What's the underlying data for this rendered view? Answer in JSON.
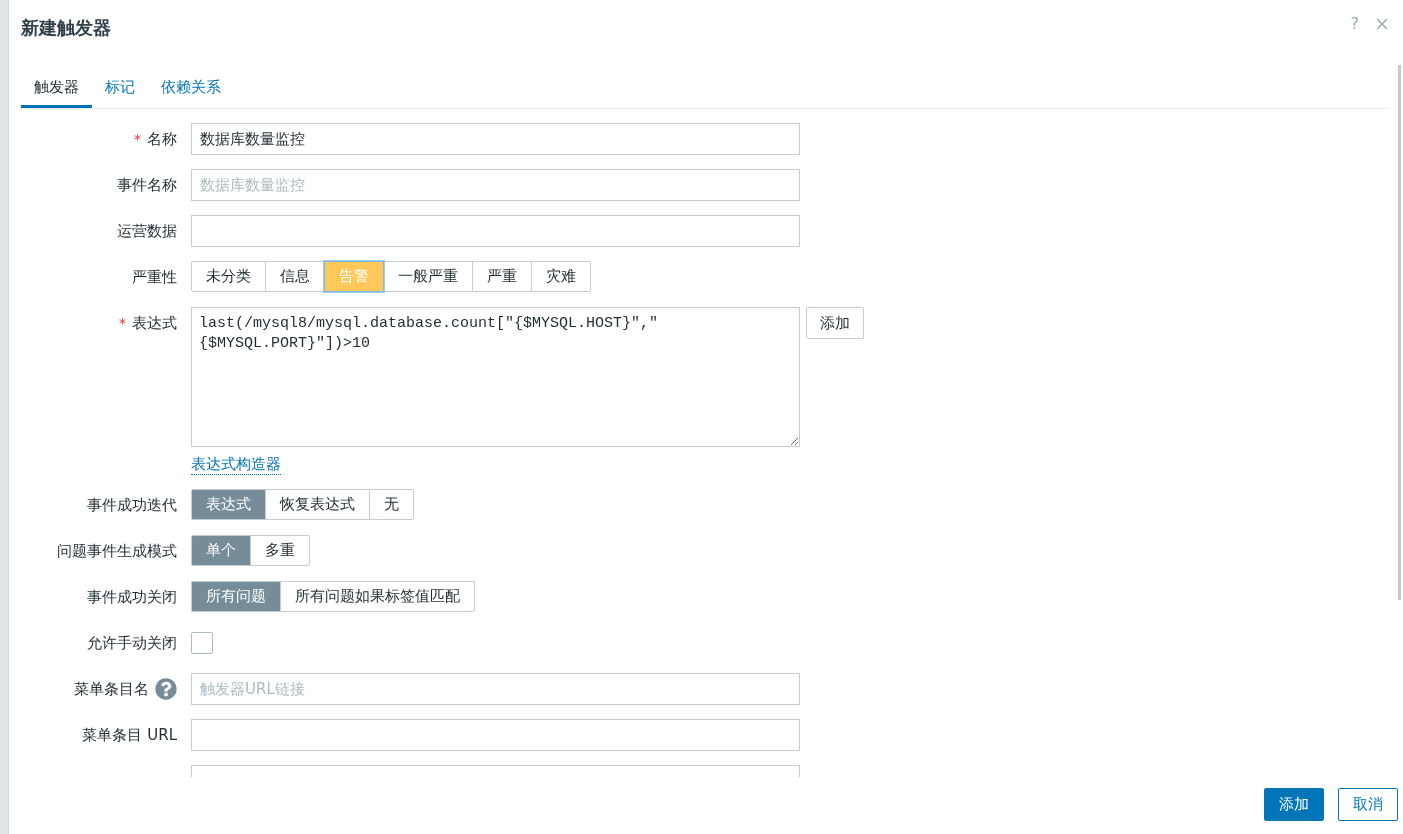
{
  "dialog": {
    "title": "新建触发器",
    "help": "?"
  },
  "tabs": [
    {
      "label": "触发器",
      "selected": true
    },
    {
      "label": "标记",
      "selected": false
    },
    {
      "label": "依赖关系",
      "selected": false
    }
  ],
  "form": [
    {
      "kind": "text",
      "label": "名称",
      "mark": "*",
      "value": "数据库数量监控"
    },
    {
      "kind": "text",
      "label": "事件名称",
      "placeholder": "数据库数量监控"
    },
    {
      "kind": "text",
      "label": "运营数据"
    },
    {
      "kind": "severity",
      "label": "严重性",
      "options": [
        {
          "label": "未分类",
          "selected": false
        },
        {
          "label": "信息",
          "selected": false
        },
        {
          "label": "告警",
          "selected": true
        },
        {
          "label": "一般严重",
          "selected": false
        },
        {
          "label": "严重",
          "selected": false
        },
        {
          "label": "灾难",
          "selected": false
        }
      ]
    },
    {
      "kind": "expression",
      "label": "表达式",
      "mark": "*",
      "value": "last(/mysql8/mysql.database.count[\"{$MYSQL.HOST}\",\"{$MYSQL.PORT}\"])>10",
      "button": "添加",
      "link": "表达式构造器"
    },
    {
      "kind": "segmented",
      "label": "事件成功迭代",
      "options": [
        {
          "label": "表达式",
          "selected": true
        },
        {
          "label": "恢复表达式",
          "selected": false
        },
        {
          "label": "无",
          "selected": false
        }
      ]
    },
    {
      "kind": "segmented",
      "label": "问题事件生成模式",
      "options": [
        {
          "label": "单个",
          "selected": true
        },
        {
          "label": "多重",
          "selected": false
        }
      ]
    },
    {
      "kind": "segmented",
      "label": "事件成功关闭",
      "options": [
        {
          "label": "所有问题",
          "selected": true
        },
        {
          "label": "所有问题如果标签值匹配",
          "selected": false
        }
      ]
    },
    {
      "kind": "checkbox",
      "label": "允许手动关闭",
      "checked": false
    },
    {
      "kind": "text",
      "label": "菜单条目名",
      "help": true,
      "placeholder": "触发器URL链接"
    },
    {
      "kind": "text",
      "label": "菜单条目 URL"
    },
    {
      "kind": "text"
    }
  ],
  "footer": {
    "buttons": [
      {
        "label": "添加",
        "kind": "primary"
      },
      {
        "label": "取消",
        "kind": "secondary"
      }
    ]
  }
}
